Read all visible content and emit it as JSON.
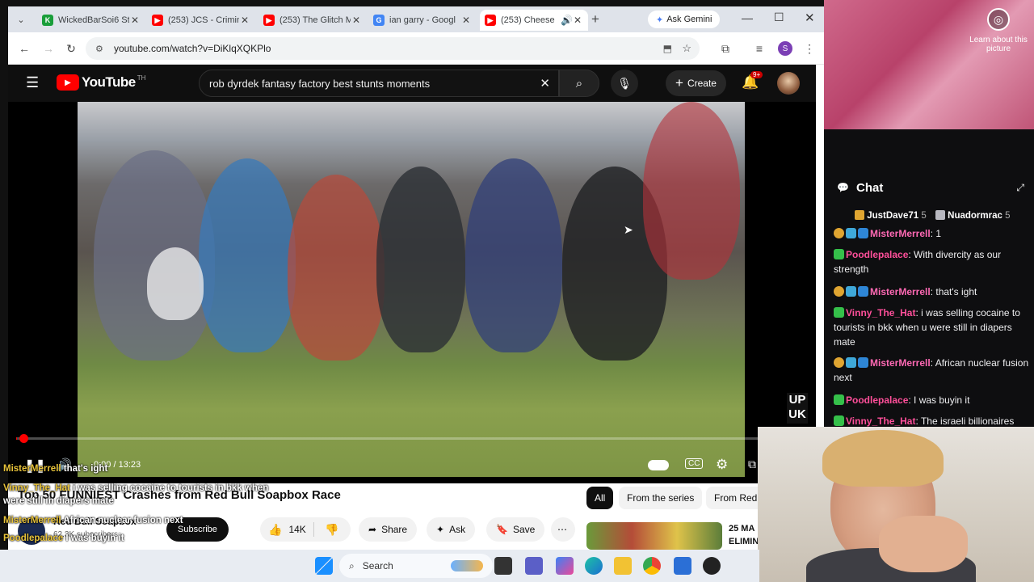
{
  "browser": {
    "tabs": [
      {
        "title": "WickedBarSoi6 St",
        "fav_color": "#1a9e3a",
        "fav_letter": "K"
      },
      {
        "title": "(253) JCS - Crimin",
        "fav_color": "#ff0000",
        "fav_letter": "▶"
      },
      {
        "title": "(253) The Glitch M",
        "fav_color": "#ff0000",
        "fav_letter": "▶"
      },
      {
        "title": "ian garry - Googl",
        "fav_color": "#4285f4",
        "fav_letter": "G"
      },
      {
        "title": "(253) Cheese",
        "fav_color": "#ff0000",
        "fav_letter": "▶"
      }
    ],
    "new_tab": "+",
    "ask_gemini": "Ask Gemini",
    "url": "youtube.com/watch?v=DiKlqXQKPlo",
    "profile_letter": "S"
  },
  "youtube": {
    "logo_text": "YouTube",
    "logo_suffix": "TH",
    "search_value": "rob dyrdek fantasy factory best stunts moments",
    "create_label": "Create",
    "notif_count": "9+",
    "time": "0:00 / 13:23",
    "watermark_top": "UP",
    "watermark_bottom": "UK",
    "title": "Top 50 FUNNIEST Crashes from Red Bull Soapbox Race",
    "channel": "Red Bull Soapbox",
    "subscribers": "62.3K subscribers",
    "subscribe": "Subscribe",
    "likes": "14K",
    "share": "Share",
    "ask": "Ask",
    "save": "Save",
    "chips": [
      "All",
      "From the series",
      "From Red B"
    ],
    "rec_text_1": "25 MA",
    "rec_text_2": "ELIMIN"
  },
  "desktop": {
    "learn_about": "Learn about this picture"
  },
  "chat": {
    "header": "Chat",
    "pinned": [
      {
        "user": "JustDave71",
        "count": "5"
      },
      {
        "user": "Nuadormrac",
        "count": "5"
      }
    ],
    "messages": [
      {
        "user": "MisterMerrell",
        "color": "#ff69b4",
        "text": "1"
      },
      {
        "user": "Poodlepalace",
        "color": "#ff4f9a",
        "text": "With divercity as our strength"
      },
      {
        "user": "MisterMerrell",
        "color": "#ff69b4",
        "text": "that's ight"
      },
      {
        "user": "Vinny_The_Hat",
        "color": "#ff4f9a",
        "text": "i was selling cocaine to tourists in bkk when u were still in diapers mate"
      },
      {
        "user": "MisterMerrell",
        "color": "#ff69b4",
        "text": "African nuclear fusion next"
      },
      {
        "user": "Poodlepalace",
        "color": "#ff4f9a",
        "text": "I was buyin it"
      },
      {
        "user": "Vinny_The_Hat",
        "color": "#ff4f9a",
        "text": "The israeli billionaires"
      }
    ]
  },
  "overlay_chat": [
    {
      "user": "MisterMerrell",
      "text": "that's ight"
    },
    {
      "user": "Vinny_The_Hat",
      "text": "i was selling cocaine to tourists in bkk when"
    },
    {
      "user": "",
      "text": "were still in diapers mate"
    },
    {
      "user": "MisterMerrell",
      "text": "African nuclear fusion next"
    },
    {
      "user": "Poodlepalace",
      "text": "I was buyin it"
    },
    {
      "user": "Vinny_The_Hat",
      "text": "The israeli billionaires are right, America"
    },
    {
      "user": "",
      "text": "needs open-borders 100%"
    }
  ],
  "taskbar": {
    "search": "Search"
  }
}
